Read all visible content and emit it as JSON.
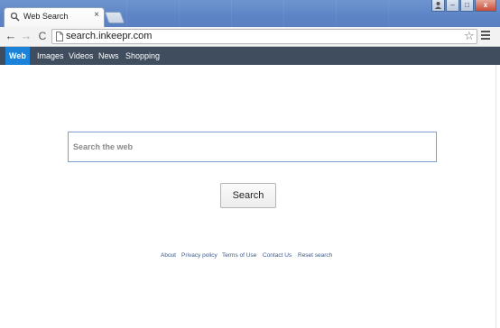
{
  "tab": {
    "icon": "search-icon",
    "title": "Web Search",
    "close_glyph": "×"
  },
  "window_controls": {
    "user_icon": "person-icon",
    "minimize_glyph": "–",
    "maximize_glyph": "□",
    "close_glyph": "x"
  },
  "toolbar": {
    "back_glyph": "←",
    "forward_glyph": "→",
    "reload_glyph": "C",
    "url": "search.inkeepr.com",
    "bookmark_glyph": "☆"
  },
  "search_nav": {
    "items": [
      {
        "label": "Web",
        "active": true
      },
      {
        "label": "Images",
        "active": false
      },
      {
        "label": "Videos",
        "active": false
      },
      {
        "label": "News",
        "active": false
      },
      {
        "label": "Shopping",
        "active": false
      }
    ]
  },
  "search": {
    "placeholder": "Search the web",
    "button_label": "Search"
  },
  "footer": {
    "links": [
      "About",
      "Privacy policy",
      "Terms of Use",
      "Contact Us",
      "Reset search"
    ]
  },
  "colors": {
    "nav_bar": "#3f4d5e",
    "nav_active": "#1a82d8",
    "search_border": "#7d9ed1",
    "footer_link": "#3d5a86"
  }
}
